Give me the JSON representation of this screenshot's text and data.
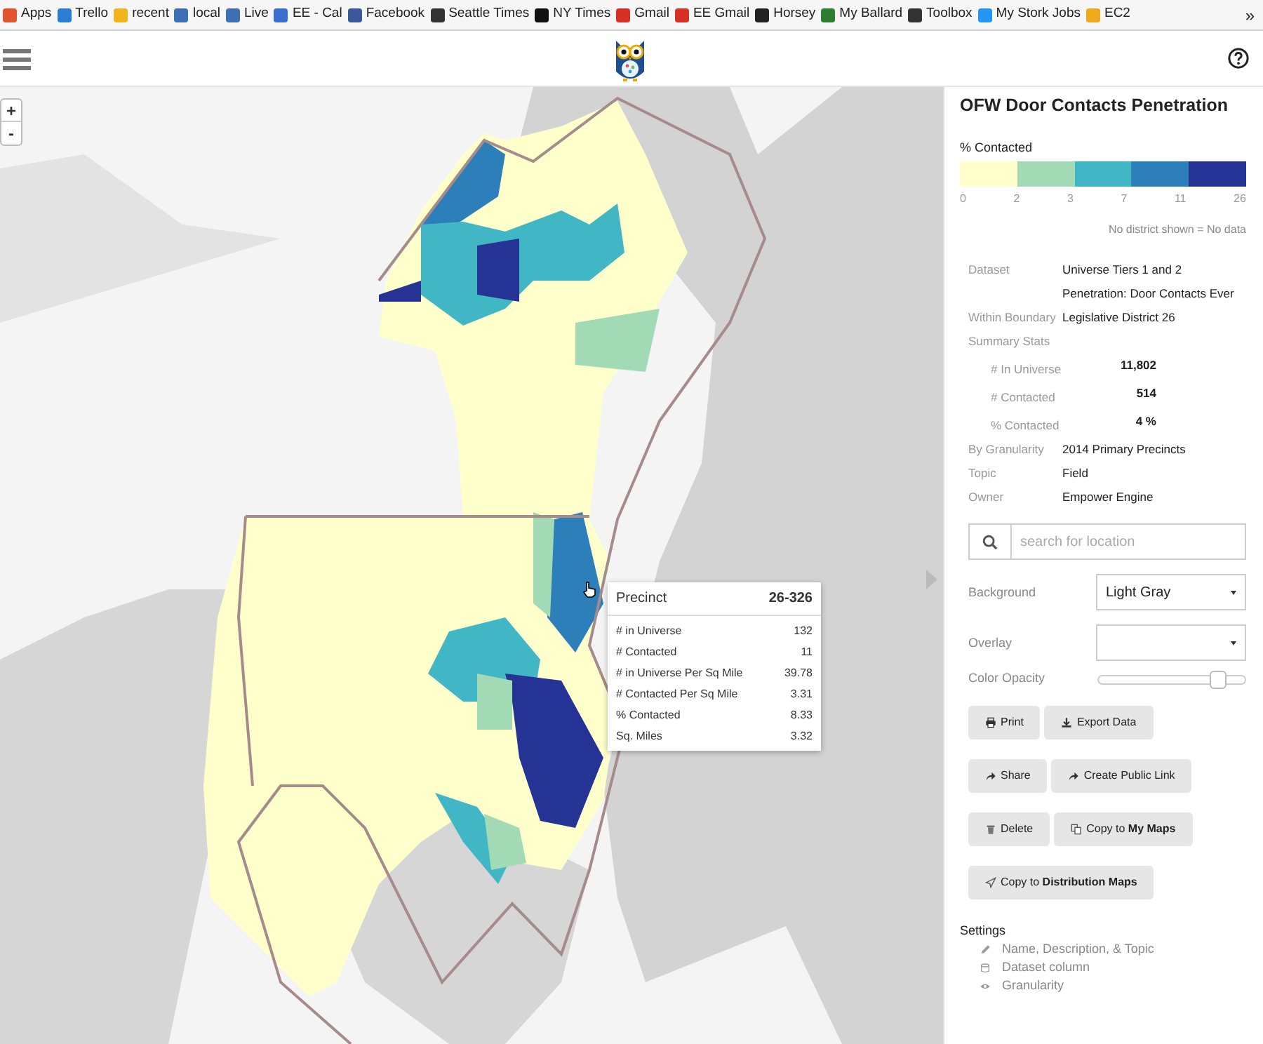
{
  "bookmarks": [
    {
      "label": "Apps",
      "color": "#e0542e"
    },
    {
      "label": "Trello",
      "color": "#2a7fd4"
    },
    {
      "label": "recent",
      "color": "#f2b41b"
    },
    {
      "label": "local",
      "color": "#3d6fb5"
    },
    {
      "label": "Live",
      "color": "#3d6fb5"
    },
    {
      "label": "EE - Cal",
      "color": "#3b6fd0"
    },
    {
      "label": "Facebook",
      "color": "#3b5998"
    },
    {
      "label": "Seattle Times",
      "color": "#333333"
    },
    {
      "label": "NY Times",
      "color": "#111111"
    },
    {
      "label": "Gmail",
      "color": "#d93025"
    },
    {
      "label": "EE Gmail",
      "color": "#d93025"
    },
    {
      "label": "Horsey",
      "color": "#222222"
    },
    {
      "label": "My Ballard",
      "color": "#2e7d32"
    },
    {
      "label": "Toolbox",
      "color": "#333333"
    },
    {
      "label": "My Stork Jobs",
      "color": "#2196f3"
    },
    {
      "label": "EC2",
      "color": "#f0a81c"
    }
  ],
  "bookmarks_overflow": "»",
  "map": {
    "zoom_in": "+",
    "zoom_out": "-",
    "tooltip": {
      "title": "Precinct",
      "id": "26-326",
      "rows": [
        {
          "label": "# in Universe",
          "value": "132"
        },
        {
          "label": "# Contacted",
          "value": "11"
        },
        {
          "label": "# in Universe Per Sq Mile",
          "value": "39.78"
        },
        {
          "label": "# Contacted Per Sq Mile",
          "value": "3.31"
        },
        {
          "label": "% Contacted",
          "value": "8.33"
        },
        {
          "label": "Sq. Miles",
          "value": "3.32"
        }
      ]
    }
  },
  "panel": {
    "title": "OFW Door Contacts Penetration",
    "legend": {
      "label": "% Contacted",
      "swatches": [
        {
          "color": "#ffffcc"
        },
        {
          "color": "#a1dab4"
        },
        {
          "color": "#41b6c4"
        },
        {
          "color": "#2c7fb8"
        },
        {
          "color": "#253494"
        }
      ],
      "ticks": [
        "0",
        "2",
        "3",
        "7",
        "11",
        "26"
      ],
      "note": "No district shown = No data"
    },
    "details": [
      {
        "label": "Dataset",
        "value": "Universe Tiers 1 and 2 Penetration: Door Contacts Ever"
      },
      {
        "label": "Within Boundary",
        "value": "Legislative District 26"
      },
      {
        "label": "Summary Stats",
        "stats": [
          {
            "label": "# In Universe",
            "value": "11,802"
          },
          {
            "label": "# Contacted",
            "value": "514"
          },
          {
            "label": "% Contacted",
            "value": "4 %"
          }
        ]
      },
      {
        "label": "By Granularity",
        "value": "2014 Primary Precincts"
      },
      {
        "label": "Topic",
        "value": "Field"
      },
      {
        "label": "Owner",
        "value": "Empower Engine"
      }
    ],
    "search": {
      "placeholder": "search for location"
    },
    "background": {
      "label": "Background",
      "value": "Light Gray"
    },
    "overlay": {
      "label": "Overlay"
    },
    "opacity": {
      "label": "Color Opacity",
      "level": 0.82
    },
    "button_rows": [
      [
        {
          "label": "Print",
          "kind": "print"
        },
        {
          "label": "Export Data",
          "kind": "download"
        }
      ],
      [
        {
          "label": "Share",
          "kind": "share"
        },
        {
          "label": "Create Public Link",
          "kind": "share"
        }
      ],
      [
        {
          "label": "Delete",
          "kind": "trash"
        },
        {
          "label": "Copy to **My Maps**",
          "kind": "copy"
        }
      ],
      [
        {
          "label": "Copy to **Distribution Maps**",
          "kind": "send"
        }
      ]
    ],
    "settings": {
      "title": "Settings",
      "items": [
        {
          "label": "Name, Description, & Topic",
          "kind": "pencil"
        },
        {
          "label": "Dataset column",
          "kind": "database"
        },
        {
          "label": "Granularity",
          "kind": "eye"
        }
      ]
    }
  }
}
